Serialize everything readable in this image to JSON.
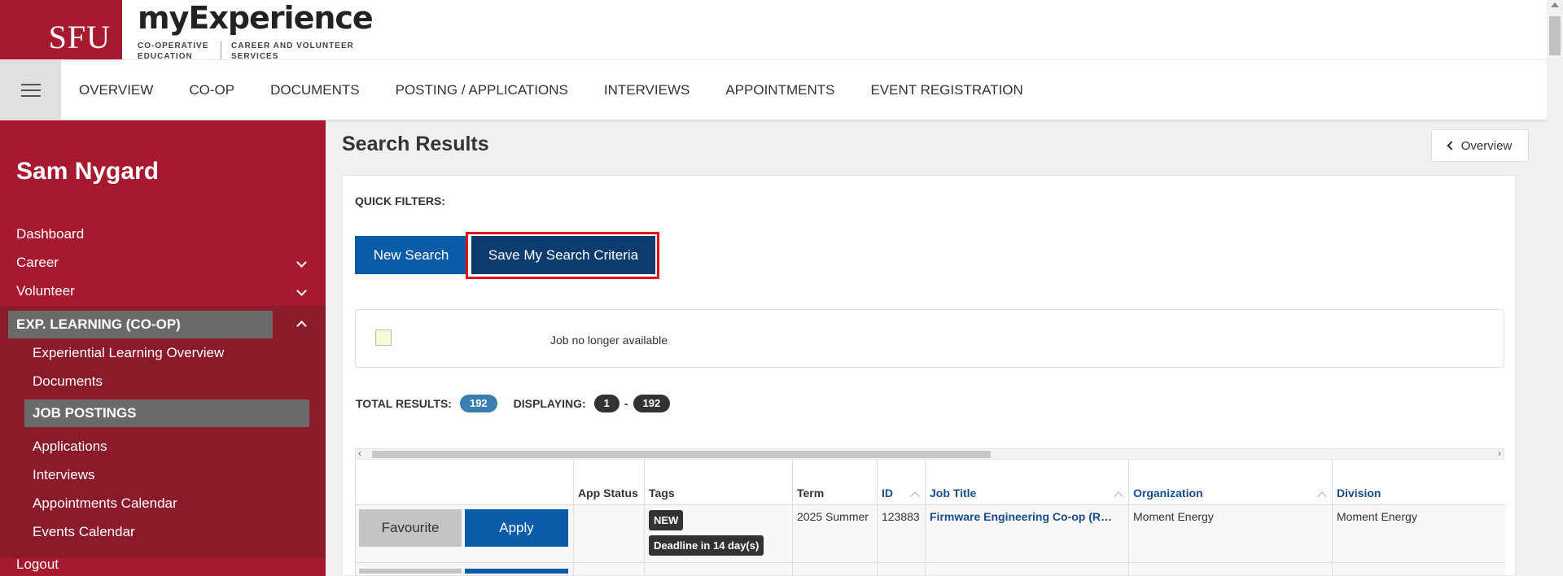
{
  "header": {
    "logo_text": "SFU",
    "brand_title": "myExperience",
    "brand_sub1": "CO-OPERATIVE EDUCATION",
    "brand_sub2": "CAREER AND VOLUNTEER SERVICES"
  },
  "topnav": {
    "items": [
      "OVERVIEW",
      "CO-OP",
      "DOCUMENTS",
      "POSTING / APPLICATIONS",
      "INTERVIEWS",
      "APPOINTMENTS",
      "EVENT REGISTRATION"
    ]
  },
  "sidebar": {
    "user_name": "Sam Nygard",
    "dashboard": "Dashboard",
    "career": "Career",
    "volunteer": "Volunteer",
    "section_head": "EXP. LEARNING (CO-OP)",
    "sub_items": [
      "Experiential Learning Overview",
      "Documents",
      "JOB POSTINGS",
      "Applications",
      "Interviews",
      "Appointments Calendar",
      "Events Calendar"
    ],
    "logout": "Logout"
  },
  "main": {
    "page_title": "Search Results",
    "overview_button": "Overview",
    "quick_filters_label": "QUICK FILTERS:",
    "new_search_button": "New Search",
    "save_criteria_button": "Save My Search Criteria",
    "legend_text": "Job no longer available",
    "total_results_label": "TOTAL RESULTS:",
    "total_results_value": "192",
    "displaying_label": "DISPLAYING:",
    "displaying_from": "1",
    "displaying_to": "192"
  },
  "table": {
    "headers": [
      "",
      "App Status",
      "Tags",
      "Term",
      "ID",
      "Job Title",
      "Organization",
      "Division"
    ],
    "rows": [
      {
        "favourite_label": "Favourite",
        "apply_label": "Apply",
        "app_status": "",
        "tag_new": "NEW",
        "tag_deadline": "Deadline in 14 day(s)",
        "term": "2025 Summer",
        "id": "123883",
        "job_title": "Firmware Engineering Co-op (R…",
        "organization": "Moment Energy",
        "division": "Moment Energy"
      }
    ]
  },
  "colors": {
    "sidebar_bg": "#a6192e",
    "sidebar_section_bg": "#8b1a2a",
    "primary_button": "#0a5ba8",
    "save_button": "#0c3b70",
    "highlight_outline": "#e1101c",
    "results_pill": "#3a7fb0"
  }
}
